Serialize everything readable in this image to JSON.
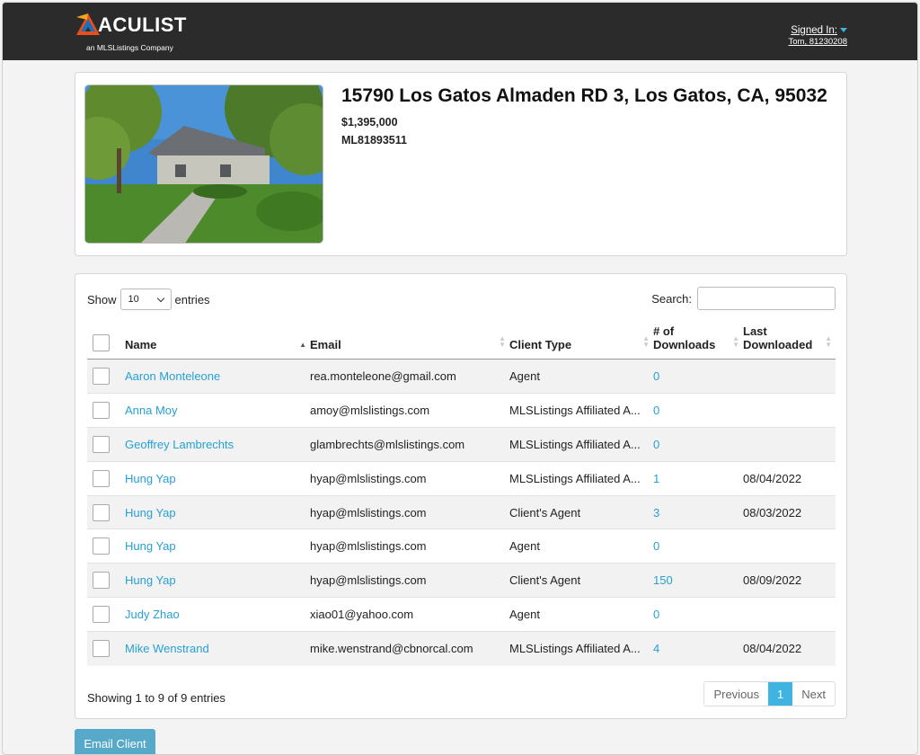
{
  "header": {
    "brand": "ACULIST",
    "tagline": "an MLSListings Company",
    "signed_in_label": "Signed In:",
    "user": "Tom, 81230208"
  },
  "listing": {
    "address": "15790 Los Gatos Almaden RD 3, Los Gatos, CA, 95032",
    "price": "$1,395,000",
    "mls_number": "ML81893511"
  },
  "table": {
    "show_label": "Show",
    "entries_label": "entries",
    "page_size": "10",
    "search_label": "Search:",
    "search_value": "",
    "columns": [
      "Name",
      "Email",
      "Client Type",
      "# of Downloads",
      "Last Downloaded"
    ],
    "rows": [
      {
        "name": "Aaron Monteleone",
        "email": "rea.monteleone@gmail.com",
        "client_type": "Agent",
        "downloads": "0",
        "last": ""
      },
      {
        "name": "Anna Moy",
        "email": "amoy@mlslistings.com",
        "client_type": "MLSListings Affiliated A...",
        "downloads": "0",
        "last": ""
      },
      {
        "name": "Geoffrey Lambrechts",
        "email": "glambrechts@mlslistings.com",
        "client_type": "MLSListings Affiliated A...",
        "downloads": "0",
        "last": ""
      },
      {
        "name": "Hung Yap",
        "email": "hyap@mlslistings.com",
        "client_type": "MLSListings Affiliated A...",
        "downloads": "1",
        "last": "08/04/2022"
      },
      {
        "name": "Hung Yap",
        "email": "hyap@mlslistings.com",
        "client_type": "Client's Agent",
        "downloads": "3",
        "last": "08/03/2022"
      },
      {
        "name": "Hung Yap",
        "email": "hyap@mlslistings.com",
        "client_type": "Agent",
        "downloads": "0",
        "last": ""
      },
      {
        "name": "Hung Yap",
        "email": "hyap@mlslistings.com",
        "client_type": "Client's Agent",
        "downloads": "150",
        "last": "08/09/2022"
      },
      {
        "name": "Judy Zhao",
        "email": "xiao01@yahoo.com",
        "client_type": "Agent",
        "downloads": "0",
        "last": ""
      },
      {
        "name": "Mike Wenstrand",
        "email": "mike.wenstrand@cbnorcal.com",
        "client_type": "MLSListings Affiliated A...",
        "downloads": "4",
        "last": "08/04/2022"
      }
    ],
    "info": "Showing 1 to 9 of 9 entries",
    "pager": {
      "previous": "Previous",
      "current": "1",
      "next": "Next"
    }
  },
  "actions": {
    "email_client": "Email Client"
  },
  "colors": {
    "accent": "#3fb4e0",
    "link": "#27a0d6",
    "header_bg": "#2b2b2b",
    "button": "#57a9c9"
  }
}
